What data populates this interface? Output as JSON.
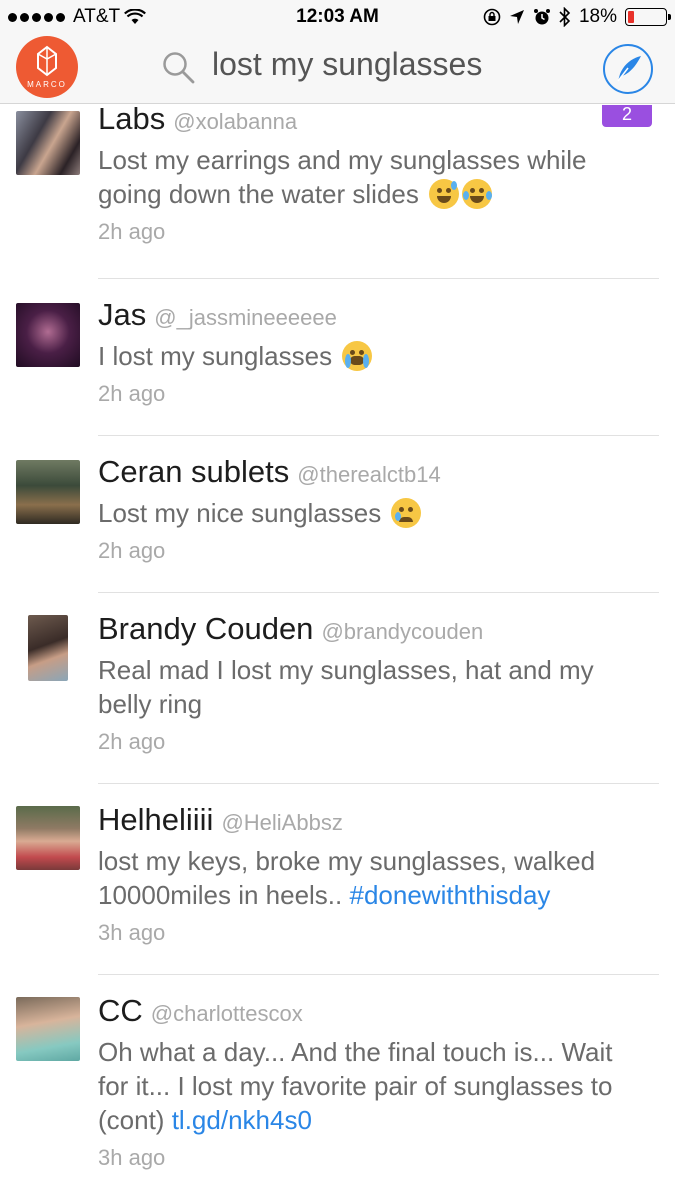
{
  "status_bar": {
    "carrier": "AT&T",
    "time": "12:03 AM",
    "battery": "18%",
    "battery_level": 0.18,
    "battery_color": "#e8312a"
  },
  "nav": {
    "logo_text": "MARCO",
    "search_query": "lost my sunglasses",
    "search_icon": "search-icon",
    "compose_icon": "quill-compose-icon",
    "accent_color": "#2a86e6",
    "logo_color": "#ee5a33"
  },
  "tweets": [
    {
      "name": "Labs",
      "handle": "@xolabanna",
      "text": "Lost my earrings and my sunglasses while going down the water slides",
      "emojis": [
        "sweat-smile-emoji",
        "tears-of-joy-emoji"
      ],
      "time": "2h ago",
      "badge": "2"
    },
    {
      "name": "Jas",
      "handle": "@_jassmineeeeee",
      "text": "I lost my sunglasses",
      "emojis": [
        "loudly-crying-emoji"
      ],
      "time": "2h ago"
    },
    {
      "name": "Ceran sublets",
      "handle": "@therealctb14",
      "text": "Lost my nice sunglasses",
      "emojis": [
        "crying-face-emoji"
      ],
      "time": "2h ago"
    },
    {
      "name": "Brandy Couden",
      "handle": "@brandycouden",
      "text": "Real mad I lost my sunglasses, hat and my belly ring",
      "time": "2h ago"
    },
    {
      "name": "Helheliiii",
      "handle": "@HeliAbbsz",
      "text": "lost my keys, broke my sunglasses, walked 10000miles in heels..",
      "hashtag": "#donewiththisday",
      "time": "3h ago"
    },
    {
      "name": "CC",
      "handle": "@charlottescox",
      "text": "Oh what a day... And the final touch is... Wait for it... I lost my favorite pair of sunglasses to (cont)",
      "link": "tl.gd/nkh4s0",
      "time": "3h ago"
    }
  ]
}
